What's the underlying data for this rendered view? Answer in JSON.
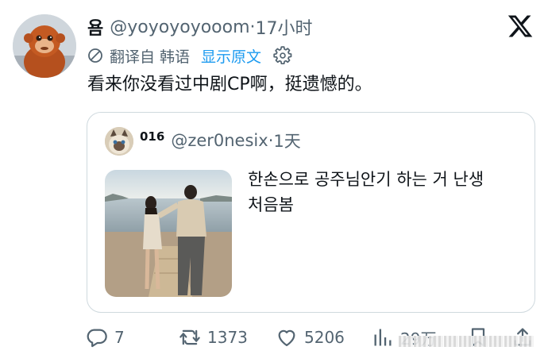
{
  "tweet": {
    "author_name": "욤",
    "handle": "@yoyoyoyooom",
    "separator": "·",
    "time": "17小时",
    "translation": {
      "translated_from": "翻译自 韩语",
      "show_original": "显示原文"
    },
    "text": "看来你没看过中剧CP啊，挺遗憾的。"
  },
  "quoted_tweet": {
    "author_name": "016",
    "handle": "@zer0nesix",
    "separator": "·",
    "time": "1天",
    "text_line1": "한손으로 공주님안기 하는 거 난생",
    "text_line2": "처음봄"
  },
  "actions": {
    "replies": "7",
    "retweets": "1373",
    "likes": "5206",
    "views": "29万"
  },
  "icons": {
    "close": "x-logo-icon",
    "translate": "translate-icon",
    "settings": "gear-icon",
    "reply": "reply-icon",
    "retweet": "retweet-icon",
    "like": "heart-icon",
    "views": "views-icon",
    "bookmark": "bookmark-icon",
    "share": "share-icon"
  },
  "colors": {
    "link": "#1d9bf0",
    "secondary_text": "#536471",
    "border": "#cfd9de"
  }
}
